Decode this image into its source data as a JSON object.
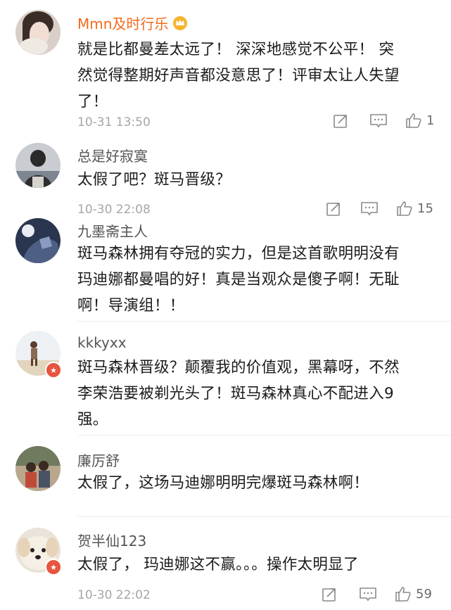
{
  "comments": [
    {
      "username": "Mmn及时行乐",
      "lines": [
        "就是比都曼差太远了！ 深深地感觉不公平！ 突",
        "然觉得整期好声音都没意思了！评审太让人失望",
        "了！"
      ],
      "timestamp": "10-31 13:50",
      "likes": "1",
      "vip": true
    },
    {
      "username": "总是好寂寞",
      "lines": [
        "太假了吧？斑马晋级？"
      ],
      "timestamp": "10-30 22:08",
      "likes": "15"
    },
    {
      "username": "九墨斋主人",
      "lines": [
        "斑马森林拥有夺冠的实力，但是这首歌明明没有",
        "玛迪娜都曼唱的好！真是当观众是傻子啊！无耻",
        "啊！导演组！！"
      ]
    },
    {
      "username": "kkkyxx",
      "lines": [
        "斑马森林晋级？颠覆我的价值观，黑幕呀，不然",
        "李荣浩要被剃光头了！斑马森林真心不配进入9",
        "强。"
      ]
    },
    {
      "username": "廉厉舒",
      "lines": [
        "太假了，这场马迪娜明明完爆斑马森林啊！"
      ]
    },
    {
      "username": "贺半仙123",
      "lines": [
        "太假了， 玛迪娜这不赢。。。操作太明显了"
      ],
      "timestamp": "10-30 22:02",
      "likes": "59"
    }
  ],
  "icons": {
    "repost": "repost-icon",
    "comment": "comment-icon",
    "like": "thumbs-up-icon",
    "vip": "crown-badge-icon",
    "verified": "star-badge-icon"
  },
  "colors": {
    "username_vip": "#f26a1b",
    "username": "#555555",
    "text": "#1b1b1b",
    "meta": "#a6a6a6",
    "badge": "#e8543f"
  }
}
